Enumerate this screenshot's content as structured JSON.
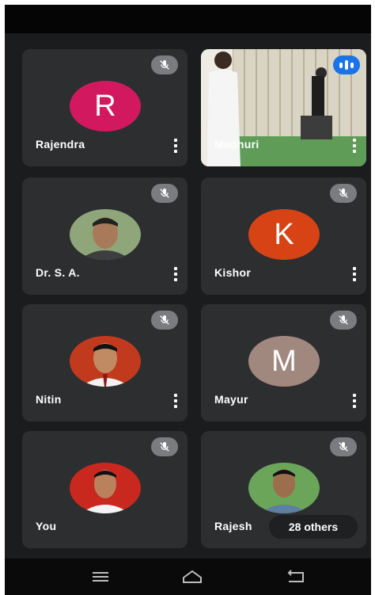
{
  "participants": [
    {
      "name": "Rajendra",
      "avatar_type": "initial",
      "initial": "R",
      "avatar_color": "#d2195f",
      "muted": true
    },
    {
      "name": "Madhuri",
      "avatar_type": "video",
      "speaking": true
    },
    {
      "name": "Dr. S. A.",
      "avatar_type": "photo",
      "muted": true
    },
    {
      "name": "Kishor",
      "avatar_type": "initial",
      "initial": "K",
      "avatar_color": "#d74315",
      "muted": true
    },
    {
      "name": "Nitin",
      "avatar_type": "photo",
      "muted": true
    },
    {
      "name": "Mayur",
      "avatar_type": "initial",
      "initial": "M",
      "avatar_color": "#a1887f",
      "muted": true
    },
    {
      "name": "You",
      "avatar_type": "photo",
      "muted": true
    },
    {
      "name": "Rajesh",
      "avatar_type": "photo",
      "muted": true
    }
  ],
  "others_label": "28 others",
  "icons": {
    "mute": "mic-off-icon",
    "speaking": "audio-level-icon",
    "more": "more-vert-icon",
    "nav": [
      "menu-icon",
      "home-icon",
      "back-icon"
    ]
  },
  "colors": {
    "background": "#1b1c1e",
    "tile": "#2d2e30",
    "speaking_indicator": "#1a73e8"
  }
}
